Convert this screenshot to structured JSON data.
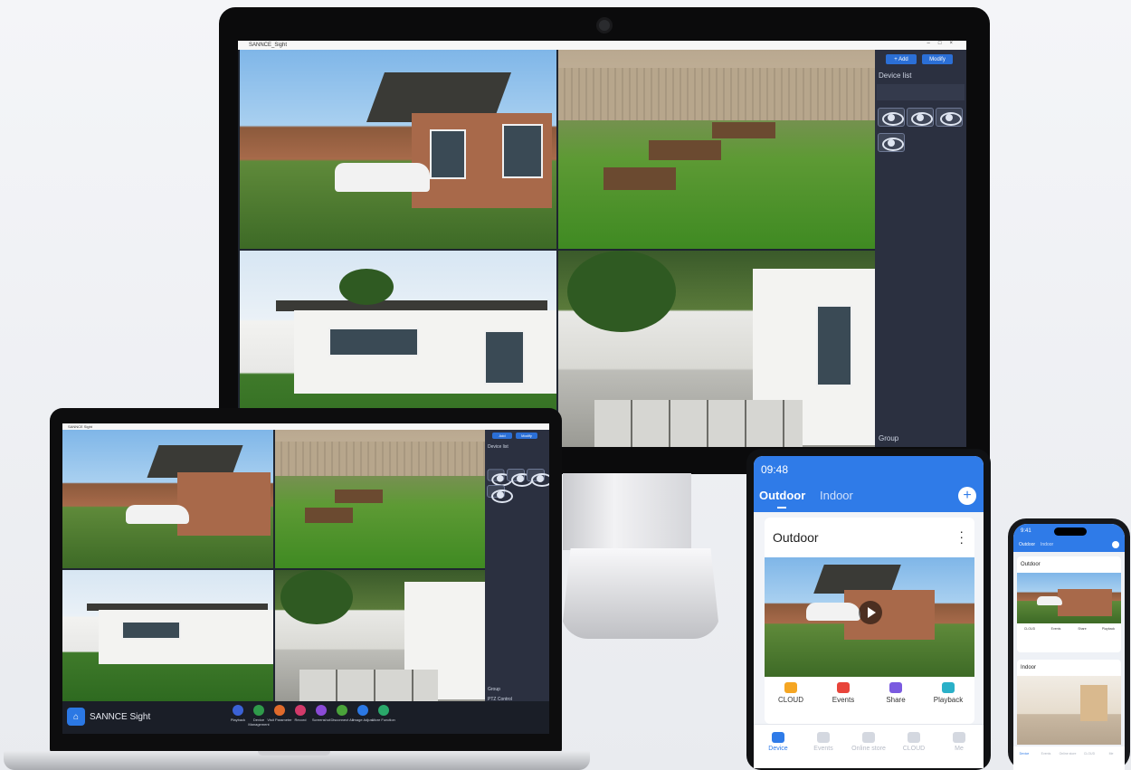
{
  "desktop": {
    "window_title": "SANNCE_Sight",
    "add_button": "+ Add",
    "modify_button": "Modify",
    "device_list_label": "Device list",
    "device_name": "",
    "group_label": "Group"
  },
  "laptop": {
    "window_title": "SANNCE Sight",
    "add_button": "Add",
    "modify_button": "Modify",
    "device_list_label": "Device list",
    "group_label": "Group",
    "ptz_label": "PTZ Control",
    "app_name": "SANNCE Sight",
    "tools": [
      {
        "label": "Playback",
        "color": "#3b62d6"
      },
      {
        "label": "Device Management",
        "color": "#2f9a4a"
      },
      {
        "label": "Visit Parameter",
        "color": "#e06a2b"
      },
      {
        "label": "Record",
        "color": "#d23a6a"
      },
      {
        "label": "Screenshot",
        "color": "#8a4ad6"
      },
      {
        "label": "Disconnect All",
        "color": "#4aa33a"
      },
      {
        "label": "Image Adjust",
        "color": "#2b78e4"
      },
      {
        "label": "More Function",
        "color": "#2aa86a"
      }
    ]
  },
  "tablet": {
    "time": "09:48",
    "status": "",
    "tab_outdoor": "Outdoor",
    "tab_indoor": "Indoor",
    "add_icon": "+",
    "card_title": "Outdoor",
    "actions": [
      {
        "label": "CLOUD",
        "color": "#f5a623"
      },
      {
        "label": "Events",
        "color": "#e8443a"
      },
      {
        "label": "Share",
        "color": "#7a5ae0"
      },
      {
        "label": "Playback",
        "color": "#2ab0c8"
      }
    ],
    "nav": [
      "Device",
      "Events",
      "Online store",
      "CLOUD",
      "Me"
    ],
    "nav_active_color": "#2f7be8"
  },
  "phone": {
    "time": "9:41",
    "tab_outdoor": "Outdoor",
    "tab_indoor": "Indoor",
    "card1_title": "Outdoor",
    "card2_title": "Indoor",
    "actions": [
      "CLOUD",
      "Events",
      "Share",
      "Playback"
    ],
    "nav": [
      "Device",
      "Events",
      "Online store",
      "CLOUD",
      "Me"
    ]
  },
  "colors": {
    "brand_blue": "#2f7be8",
    "panel_dark": "#2b3040"
  }
}
